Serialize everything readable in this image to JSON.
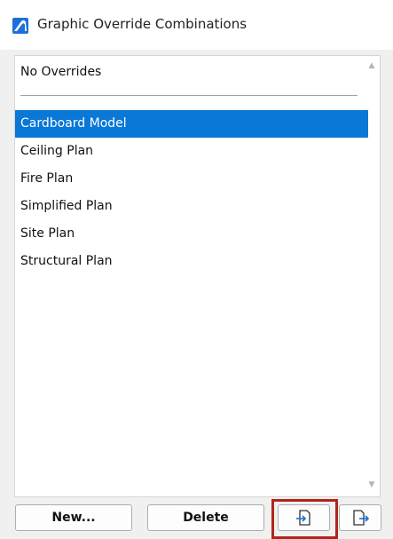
{
  "window": {
    "title": "Graphic Override Combinations",
    "app_icon": "archicad-icon"
  },
  "list": {
    "fixed_item": "No Overrides",
    "items": [
      {
        "label": "Cardboard Model",
        "selected": true
      },
      {
        "label": "Ceiling Plan",
        "selected": false
      },
      {
        "label": "Fire Plan",
        "selected": false
      },
      {
        "label": "Simplified Plan",
        "selected": false
      },
      {
        "label": "Site Plan",
        "selected": false
      },
      {
        "label": "Structural Plan",
        "selected": false
      }
    ]
  },
  "buttons": {
    "new_label": "New...",
    "delete_label": "Delete",
    "import_icon": "import-icon",
    "export_icon": "export-icon"
  },
  "colors": {
    "selection": "#0a78d7",
    "highlight": "#b0251a",
    "icon_accent": "#1e6fd9"
  }
}
